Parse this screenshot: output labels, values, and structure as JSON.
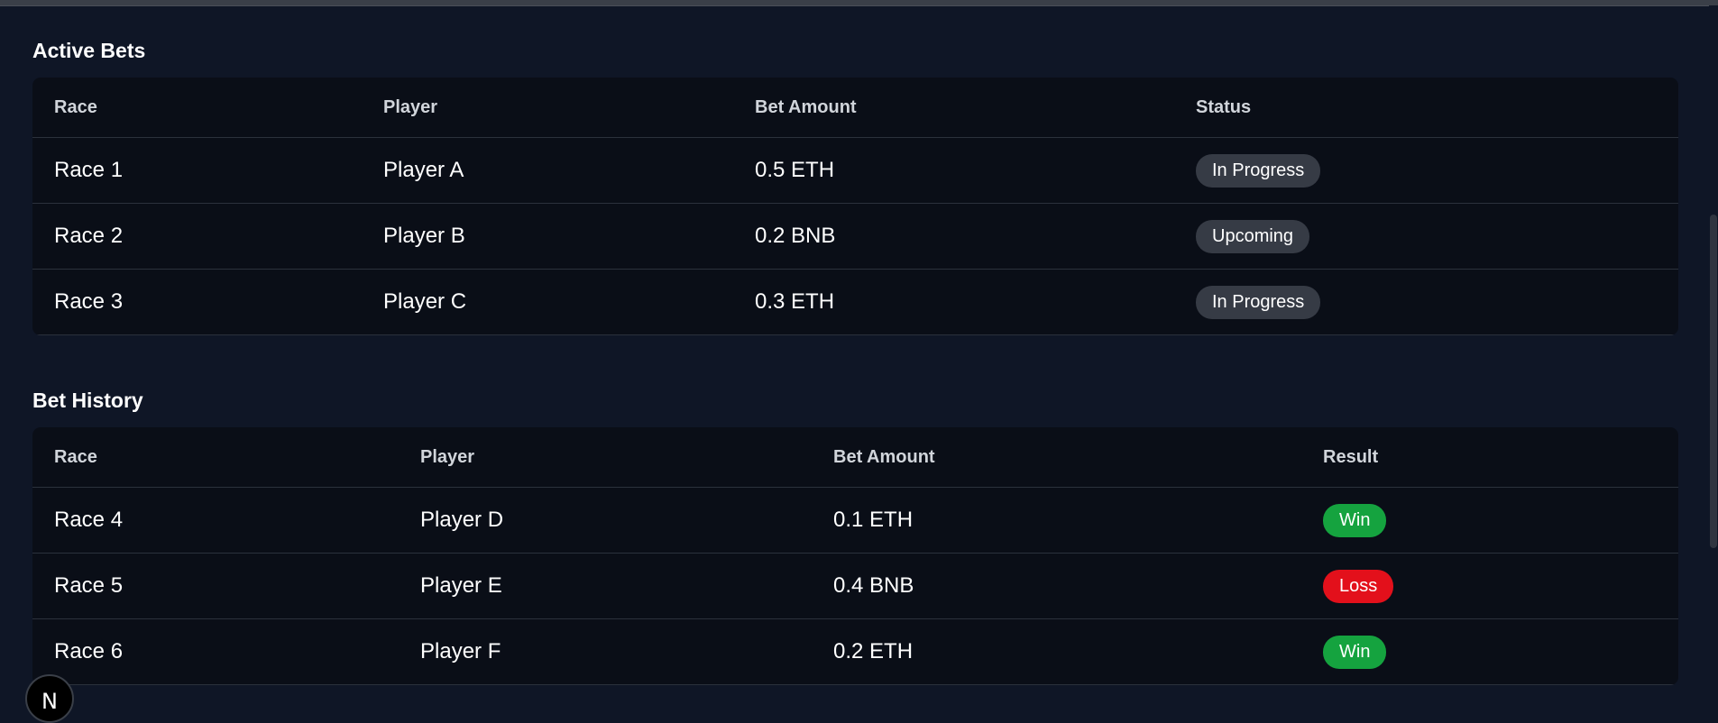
{
  "active_bets": {
    "title": "Active Bets",
    "headers": [
      "Race",
      "Player",
      "Bet Amount",
      "Status"
    ],
    "rows": [
      {
        "race": "Race 1",
        "player": "Player A",
        "amount": "0.5 ETH",
        "status": "In Progress"
      },
      {
        "race": "Race 2",
        "player": "Player B",
        "amount": "0.2 BNB",
        "status": "Upcoming"
      },
      {
        "race": "Race 3",
        "player": "Player C",
        "amount": "0.3 ETH",
        "status": "In Progress"
      }
    ]
  },
  "bet_history": {
    "title": "Bet History",
    "headers": [
      "Race",
      "Player",
      "Bet Amount",
      "Result"
    ],
    "rows": [
      {
        "race": "Race 4",
        "player": "Player D",
        "amount": "0.1 ETH",
        "result": "Win"
      },
      {
        "race": "Race 5",
        "player": "Player E",
        "amount": "0.4 BNB",
        "result": "Loss"
      },
      {
        "race": "Race 6",
        "player": "Player F",
        "amount": "0.2 ETH",
        "result": "Win"
      }
    ]
  },
  "dev_indicator": {
    "icon": "nextjs-logo-icon",
    "letter": "N"
  },
  "colors": {
    "background": "#0f1626",
    "table_bg": "#0a0e17",
    "badge_neutral": "#363b45",
    "win": "#15a33f",
    "loss": "#e3101b"
  }
}
